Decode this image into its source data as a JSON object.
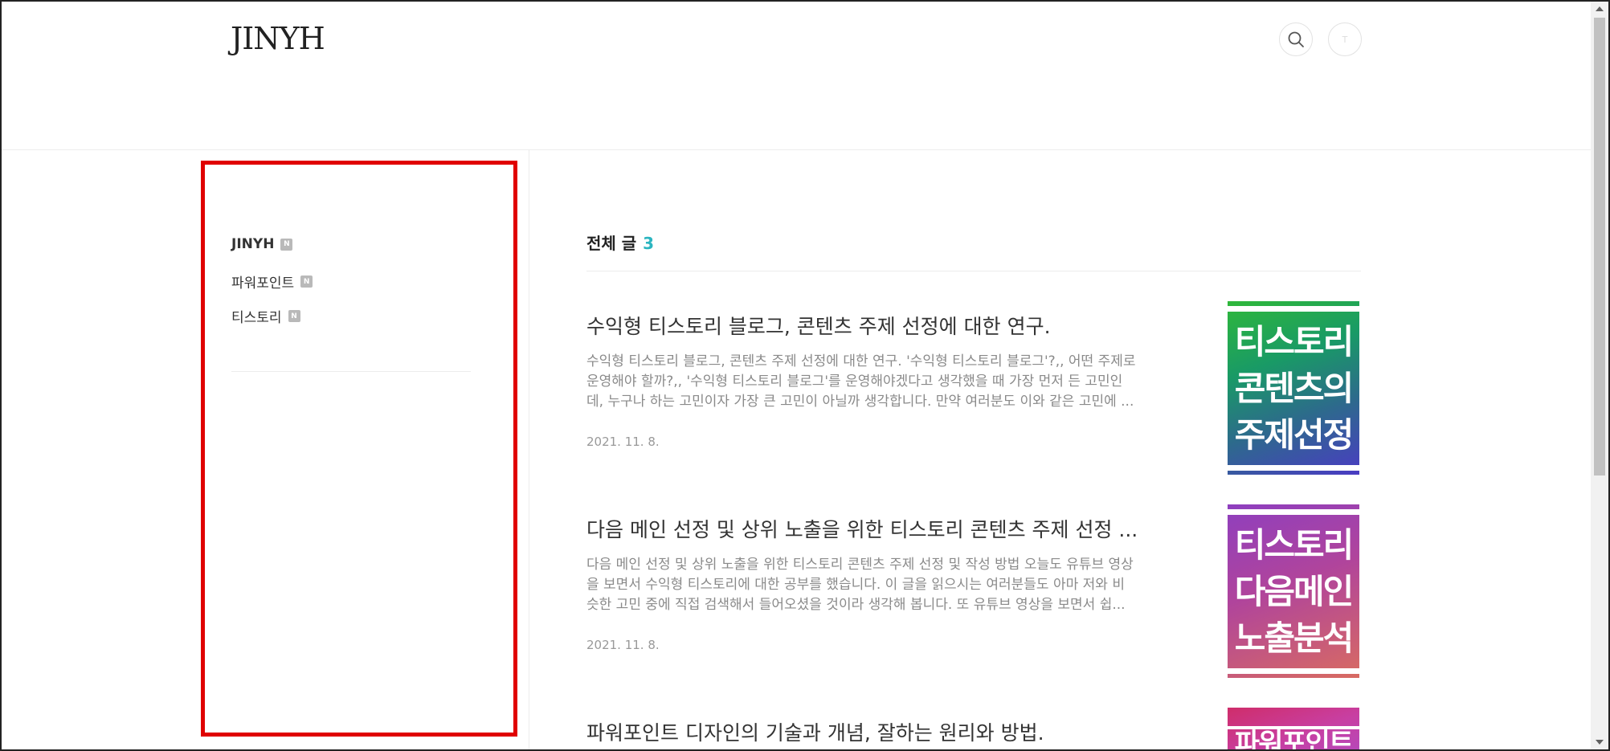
{
  "header": {
    "logo": "JINYH",
    "search_icon": "search-icon",
    "profile_initial": "T"
  },
  "sidebar": {
    "badge": "N",
    "categories": [
      {
        "label": "JINYH"
      },
      {
        "label": "파워포인트"
      },
      {
        "label": "티스토리"
      }
    ]
  },
  "main": {
    "section_title": "전체 글",
    "section_count": "3",
    "posts": [
      {
        "title": "수익형 티스토리 블로그, 콘텐츠 주제 선정에 대한 연구.",
        "excerpt": [
          "수익형 티스토리 블로그, 콘텐츠 주제 선정에 대한 연구. '수익형 티스토리 블로그'?,, 어떤 주제로",
          "운영해야 할까?,, '수익형 티스토리 블로그'를 운영해야겠다고 생각했을 때 가장 먼저 든 고민인",
          "데, 누구나 하는 고민이자 가장 큰 고민이 아닐까 생각합니다. 만약 여러분도 이와 같은 고민에 ..."
        ],
        "date": "2021. 11. 8.",
        "thumb_lines": [
          "티스토리",
          "콘텐츠의",
          "주제선정"
        ]
      },
      {
        "title": "다음 메인 선정 및 상위 노출을 위한 티스토리 콘텐츠 주제 선정 ...",
        "excerpt": [
          "다음 메인 선정 및 상위 노출을 위한 티스토리 콘텐츠 주제 선정 및 작성 방법 오늘도 유튜브 영상",
          "을 보면서 수익형 티스토리에 대한 공부를 했습니다. 이 글을 읽으시는 여러분들도 아마 저와 비",
          "슷한 고민 중에 직접 검색해서 들어오셨을 것이라 생각해 봅니다. 또 유튜브 영상을 보면서 쉽..."
        ],
        "date": "2021. 11. 8.",
        "thumb_lines": [
          "티스토리",
          "다음메인",
          "노출분석"
        ]
      },
      {
        "title": "파워포인트 디자인의 기술과 개념, 잘하는 원리와 방법.",
        "thumb_lines": [
          "파워포인트"
        ]
      }
    ]
  },
  "colors": {
    "accent": "#2bb5c0",
    "highlight_box": "#e00000"
  }
}
